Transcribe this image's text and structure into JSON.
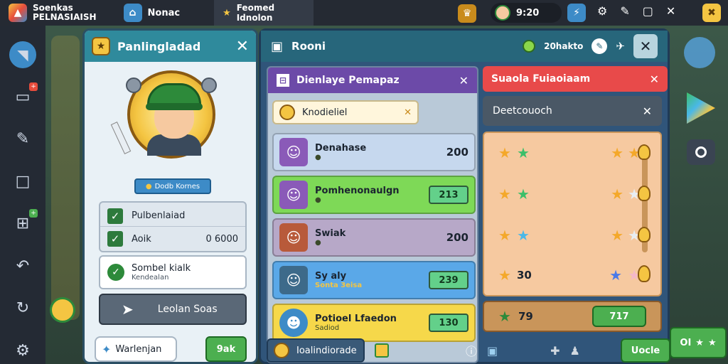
{
  "topbar": {
    "app_title_line1": "Soenkas",
    "app_title_line2": "PELNASIAISH",
    "tab1": "Nonac",
    "tab2": "Feomed Idnolon",
    "timer": "9:20"
  },
  "left_window": {
    "title": "Panlingladad",
    "name_badge": "Dodb Kornes",
    "checklist": [
      {
        "label": "Pulbenlaiad",
        "value": ""
      },
      {
        "label": "Aoik",
        "value": "0 6000"
      }
    ],
    "selected": {
      "title": "Sombel kialk",
      "subtitle": "Kendealan"
    },
    "action_button": "Leolan Soas",
    "bottom_left": "Warlenjan",
    "bottom_right": "9ak"
  },
  "room": {
    "title": "Rooni",
    "currency": "20hakto"
  },
  "player_list": {
    "header": "Dienlaye Pemapaz",
    "search_chip": "Knodieliel",
    "items": [
      {
        "name": "Denahase",
        "sub": "",
        "value": "200",
        "boxed": false
      },
      {
        "name": "Pomhenonaulgn",
        "sub": "",
        "value": "213",
        "boxed": true
      },
      {
        "name": "Swiak",
        "sub": "",
        "value": "200",
        "boxed": false
      },
      {
        "name": "Sy aly",
        "sub": "Sonta 3eisa",
        "value": "239",
        "boxed": true
      },
      {
        "name": "Potioel Lfaedon",
        "sub": "Sadiod",
        "value": "130",
        "boxed": true
      }
    ],
    "footer": "Ioalindiorade"
  },
  "rating_panel": {
    "header": "Suaola Fuiaoiaam",
    "subheader": "Deetcouoch",
    "rows": [
      {
        "left_value": ""
      },
      {
        "left_value": ""
      },
      {
        "left_value": ""
      },
      {
        "left_value": "30"
      }
    ],
    "bottom_value": "79",
    "bottom_box": "717",
    "confirm_button": "Uocle"
  },
  "right_edge_button": "OI"
}
